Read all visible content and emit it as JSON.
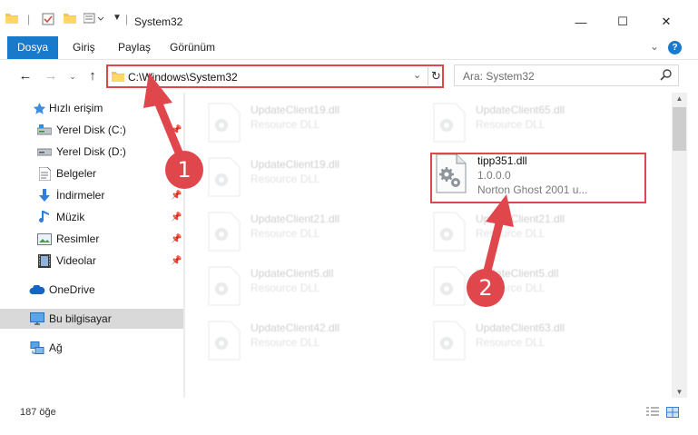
{
  "window": {
    "title": "System32",
    "controls": {
      "minimize": "—",
      "maximize": "☐",
      "close": "✕"
    }
  },
  "ribbon": {
    "tabs": [
      "Dosya",
      "Giriş",
      "Paylaş",
      "Görünüm"
    ],
    "active_tab": "Dosya",
    "expand_glyph": "⌄",
    "help_glyph": "?"
  },
  "address": {
    "path": "C:\\Windows\\System32",
    "dropdown_glyph": "⌄",
    "refresh_glyph": "↻",
    "search_placeholder": "Ara: System32"
  },
  "sidebar": {
    "items": [
      {
        "label": "Hızlı erişim",
        "icon": "star-icon",
        "pinned": false
      },
      {
        "label": "Yerel Disk (C:)",
        "icon": "drive-icon",
        "pinned": true
      },
      {
        "label": "Yerel Disk (D:)",
        "icon": "drive-icon",
        "pinned": false
      },
      {
        "label": "Belgeler",
        "icon": "documents-icon",
        "pinned": true
      },
      {
        "label": "İndirmeler",
        "icon": "download-icon",
        "pinned": true
      },
      {
        "label": "Müzik",
        "icon": "music-icon",
        "pinned": true
      },
      {
        "label": "Resimler",
        "icon": "pictures-icon",
        "pinned": true
      },
      {
        "label": "Videolar",
        "icon": "video-icon",
        "pinned": true
      },
      {
        "label": "OneDrive",
        "icon": "cloud-icon",
        "pinned": false
      },
      {
        "label": "Bu bilgisayar",
        "icon": "computer-icon",
        "pinned": false,
        "selected": true
      },
      {
        "label": "Ağ",
        "icon": "network-icon",
        "pinned": false
      }
    ]
  },
  "files": [
    {
      "name": "UpdateClient19.dll",
      "type": "Resource DLL",
      "faded": true
    },
    {
      "name": "UpdateClient65.dll",
      "type": "Resource DLL",
      "faded": true
    },
    {
      "name": "UpdateClient19.dll",
      "type": "Resource DLL",
      "faded": true
    },
    {
      "name": "tipp351.dll",
      "version": "1.0.0.0",
      "description": "Norton Ghost 2001 u...",
      "faded": false
    },
    {
      "name": "UpdateClient21.dll",
      "type": "Resource DLL",
      "faded": true
    },
    {
      "name": "UpdateClient21.dll",
      "type": "Resource DLL",
      "faded": true
    },
    {
      "name": "UpdateClient5.dll",
      "type": "Resource DLL",
      "faded": true
    },
    {
      "name": "UpdateClient5.dll",
      "type": "Resource DLL",
      "faded": true
    },
    {
      "name": "UpdateClient42.dll",
      "type": "Resource DLL",
      "faded": true
    },
    {
      "name": "UpdateClient63.dll",
      "type": "Resource DLL",
      "faded": true
    }
  ],
  "status": {
    "item_count": "187 öğe"
  },
  "annotations": {
    "step1": "1",
    "step2": "2",
    "color": "#e0474c"
  }
}
